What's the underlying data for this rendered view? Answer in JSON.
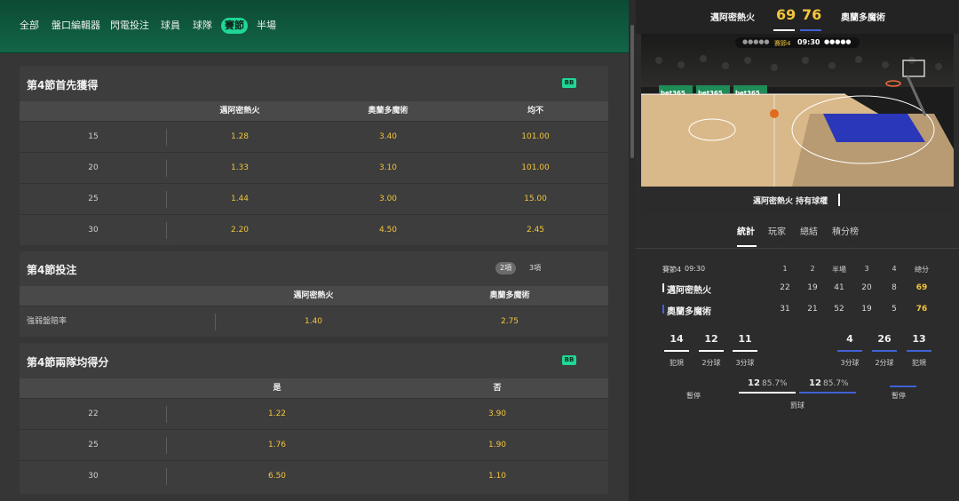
{
  "nav": {
    "tabs": [
      "全部",
      "盤口編輯器",
      "閃電投注",
      "球員",
      "球隊",
      "賽節",
      "半場"
    ],
    "active": "賽節"
  },
  "markets": {
    "m1": {
      "title": "第4節首先獲得",
      "badge": "BB",
      "headers": [
        "邁阿密熱火",
        "奧蘭多魔術",
        "均不"
      ],
      "rows": [
        {
          "label": "15",
          "odds": [
            "1.28",
            "3.40",
            "101.00"
          ]
        },
        {
          "label": "20",
          "odds": [
            "1.33",
            "3.10",
            "101.00"
          ]
        },
        {
          "label": "25",
          "odds": [
            "1.44",
            "3.00",
            "15.00"
          ]
        },
        {
          "label": "30",
          "odds": [
            "2.20",
            "4.50",
            "2.45"
          ]
        }
      ]
    },
    "m2": {
      "title": "第4節投注",
      "options": [
        "2項",
        "3項"
      ],
      "headers": [
        "邁阿密熱火",
        "奧蘭多魔術"
      ],
      "rows": [
        {
          "label": "強弱盤賠率",
          "odds": [
            "1.40",
            "2.75"
          ]
        }
      ]
    },
    "m3": {
      "title": "第4節兩隊均得分",
      "badge": "BB",
      "headers": [
        "是",
        "否"
      ],
      "rows": [
        {
          "label": "22",
          "odds": [
            "1.22",
            "3.90"
          ]
        },
        {
          "label": "25",
          "odds": [
            "1.76",
            "1.90"
          ]
        },
        {
          "label": "30",
          "odds": [
            "6.50",
            "1.10"
          ]
        }
      ]
    }
  },
  "scoreboard": {
    "home": "邁阿密熱火",
    "away": "奧蘭多魔術",
    "home_score": "69",
    "away_score": "76",
    "period": "賽節4",
    "clock": "09:30",
    "possession": "邁阿密熱火 持有球權",
    "ad_text": "bet365"
  },
  "stat_tabs": [
    "統計",
    "玩家",
    "總結",
    "積分榜"
  ],
  "stat_active": "統計",
  "box": {
    "period_label": "賽節4",
    "clock": "09:30",
    "columns": [
      "1",
      "2",
      "半場",
      "3",
      "4",
      "總分"
    ],
    "teams": [
      {
        "name": "邁阿密熱火",
        "scores": [
          "22",
          "19",
          "41",
          "20",
          "8",
          "69"
        ],
        "color": "#ffffff"
      },
      {
        "name": "奧蘭多魔術",
        "scores": [
          "31",
          "21",
          "52",
          "19",
          "5",
          "76"
        ],
        "color": "#3f63d6"
      }
    ]
  },
  "team_stats": {
    "home": [
      {
        "value": "14",
        "label": "犯規"
      },
      {
        "value": "12",
        "label": "2分球"
      },
      {
        "value": "11",
        "label": "3分球"
      }
    ],
    "away": [
      {
        "value": "4",
        "label": "3分球"
      },
      {
        "value": "26",
        "label": "2分球"
      },
      {
        "value": "13",
        "label": "犯規"
      }
    ],
    "timeouts_label": "暫停",
    "free_throws": {
      "label": "罰球",
      "home_made": "12",
      "home_pct": "85.7%",
      "away_made": "12",
      "away_pct": "85.7%"
    }
  },
  "colors": {
    "header_green": "#126647",
    "accent": "#1fd796",
    "odds": "#f2c53d",
    "away_blue": "#3f63d6"
  }
}
